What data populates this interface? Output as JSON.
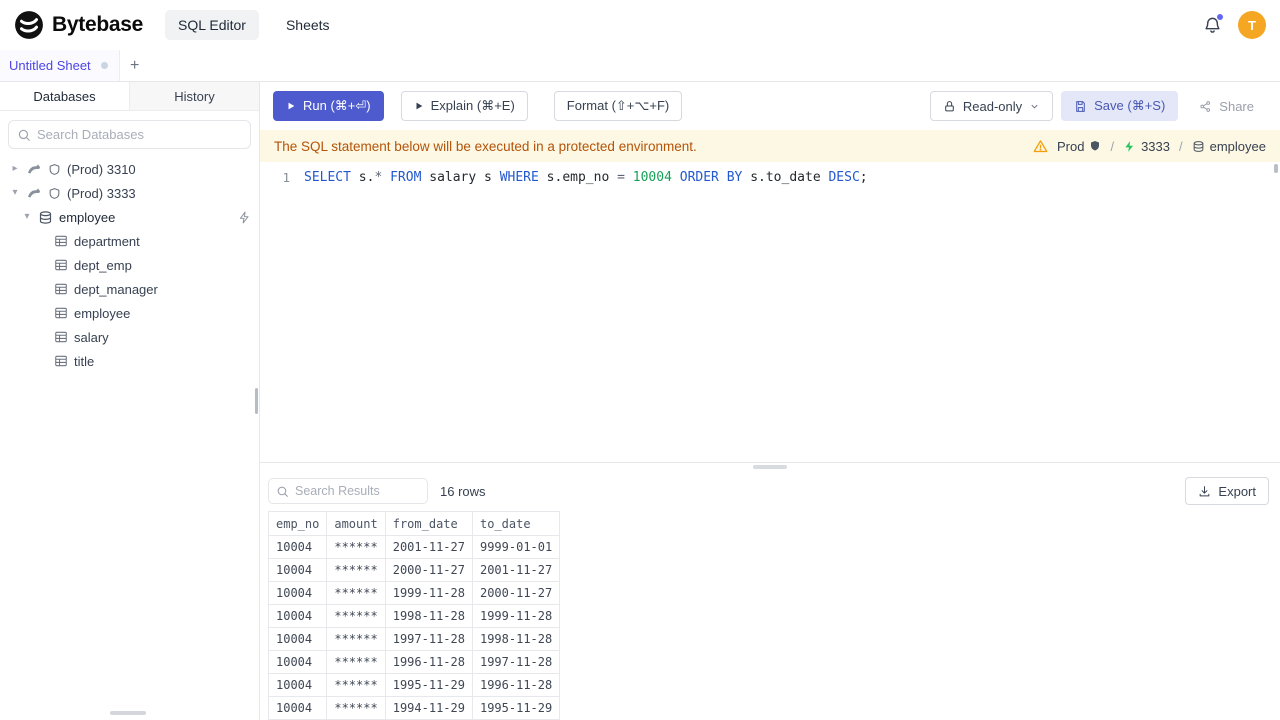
{
  "colors": {
    "accent": "#4d5bce",
    "brand": "#0b0b0b",
    "sheet_tab_text": "#4f46e5",
    "warning_bg": "#fcf8e3",
    "warning_text": "#b45309",
    "avatar_bg": "#f5a623",
    "keyword": "#2458cf",
    "number_literal": "#18a058",
    "connected_green": "#22c55e"
  },
  "icons": {
    "chevron_right": "▸",
    "chevron_down": "▾",
    "plus": "+"
  },
  "header": {
    "brand": "Bytebase",
    "nav": [
      {
        "label": "SQL Editor",
        "active": true
      },
      {
        "label": "Sheets",
        "active": false
      }
    ],
    "avatar_letter": "T"
  },
  "sheet_tab": {
    "label": "Untitled Sheet"
  },
  "sidebar": {
    "tabs": [
      {
        "label": "Databases",
        "active": true
      },
      {
        "label": "History",
        "active": false
      }
    ],
    "search_placeholder": "Search Databases",
    "tree": {
      "instances": [
        {
          "label": "(Prod) 3310",
          "expanded": false
        },
        {
          "label": "(Prod) 3333",
          "expanded": true
        }
      ],
      "database": "employee",
      "tables": [
        "department",
        "dept_emp",
        "dept_manager",
        "employee",
        "salary",
        "title"
      ]
    }
  },
  "toolbar": {
    "run": "Run (⌘+⏎)",
    "explain": "Explain (⌘+E)",
    "format": "Format (⇧+⌥+F)",
    "readonly": "Read-only",
    "save": "Save (⌘+S)",
    "share": "Share"
  },
  "banner": {
    "message": "The SQL statement below will be executed in a protected environment.",
    "environment": "Prod",
    "separator": "/",
    "instance": "3333",
    "database": "employee"
  },
  "editor": {
    "line_number": "1",
    "sql": "SELECT s.* FROM salary s WHERE s.emp_no = 10004 ORDER BY s.to_date DESC;",
    "tokens": [
      {
        "text": "SELECT",
        "type": "kw"
      },
      {
        "text": " s.",
        "type": "txt"
      },
      {
        "text": "*",
        "type": "op"
      },
      {
        "text": " ",
        "type": "txt"
      },
      {
        "text": "FROM",
        "type": "kw"
      },
      {
        "text": " salary s ",
        "type": "txt"
      },
      {
        "text": "WHERE",
        "type": "kw"
      },
      {
        "text": " s.emp_no ",
        "type": "txt"
      },
      {
        "text": "=",
        "type": "op"
      },
      {
        "text": " ",
        "type": "txt"
      },
      {
        "text": "10004",
        "type": "num"
      },
      {
        "text": " ",
        "type": "txt"
      },
      {
        "text": "ORDER BY",
        "type": "kw"
      },
      {
        "text": " s.to_date ",
        "type": "txt"
      },
      {
        "text": "DESC",
        "type": "kw"
      },
      {
        "text": ";",
        "type": "txt"
      }
    ]
  },
  "results": {
    "search_placeholder": "Search Results",
    "row_count": "16 rows",
    "export": "Export",
    "table": {
      "columns": [
        "emp_no",
        "amount",
        "from_date",
        "to_date"
      ],
      "rows": [
        [
          "10004",
          "******",
          "2001-11-27",
          "9999-01-01"
        ],
        [
          "10004",
          "******",
          "2000-11-27",
          "2001-11-27"
        ],
        [
          "10004",
          "******",
          "1999-11-28",
          "2000-11-27"
        ],
        [
          "10004",
          "******",
          "1998-11-28",
          "1999-11-28"
        ],
        [
          "10004",
          "******",
          "1997-11-28",
          "1998-11-28"
        ],
        [
          "10004",
          "******",
          "1996-11-28",
          "1997-11-28"
        ],
        [
          "10004",
          "******",
          "1995-11-29",
          "1996-11-28"
        ],
        [
          "10004",
          "******",
          "1994-11-29",
          "1995-11-29"
        ]
      ]
    }
  }
}
